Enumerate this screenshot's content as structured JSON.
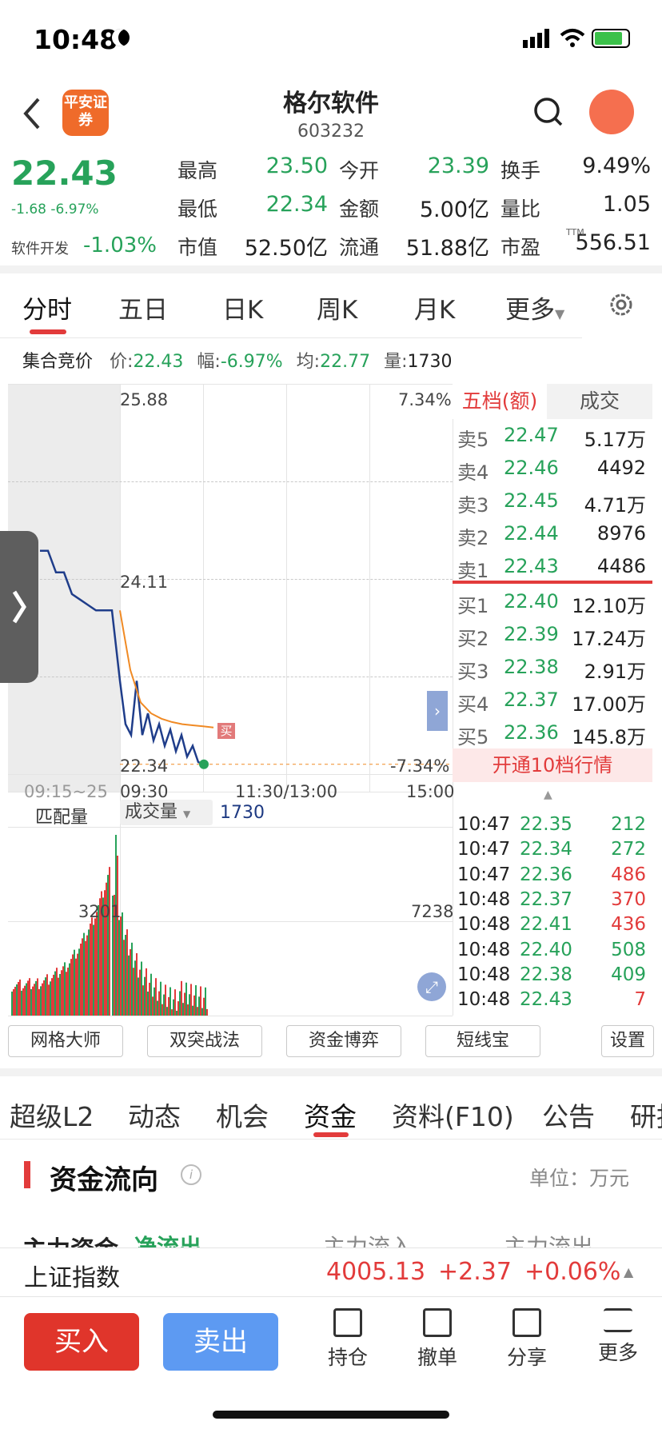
{
  "status_bar": {
    "time": "10:48"
  },
  "header": {
    "title": "格尔软件",
    "code": "603232",
    "broker_logo": "平安证券"
  },
  "quote": {
    "price": "22.43",
    "change": "-1.68",
    "change_pct": "-6.97%",
    "industry": "软件开发",
    "industry_pct": "-1.03%",
    "cells": [
      {
        "label": "最高",
        "value": "23.50",
        "color": "#27a25a"
      },
      {
        "label": "今开",
        "value": "23.39",
        "color": "#27a25a"
      },
      {
        "label": "换手",
        "value": "9.49%",
        "color": "#222"
      },
      {
        "label": "最低",
        "value": "22.34",
        "color": "#27a25a"
      },
      {
        "label": "金额",
        "value": "5.00亿",
        "color": "#222"
      },
      {
        "label": "量比",
        "value": "1.05",
        "color": "#222"
      },
      {
        "label": "市值",
        "value": "52.50亿",
        "color": "#222"
      },
      {
        "label": "流通",
        "value": "51.88亿",
        "color": "#222"
      },
      {
        "label": "市盈",
        "value": "556.51",
        "color": "#222"
      }
    ],
    "ttm_label": "TTM"
  },
  "chart_tabs": [
    "分时",
    "五日",
    "日K",
    "周K",
    "月K",
    "更多"
  ],
  "auction": {
    "label": "集合竞价",
    "price_label": "价:",
    "price": "22.43",
    "amp_label": "幅:",
    "amp": "-6.97%",
    "avg_label": "均:",
    "avg": "22.77",
    "vol_label": "量:",
    "vol": "1730"
  },
  "chart_data": {
    "type": "line",
    "y_top": "25.88",
    "y_mid": "24.11",
    "y_bot": "22.34",
    "pct_top": "7.34%",
    "pct_bot": "-7.34%",
    "x_labels": [
      "09:15~25",
      "09:30",
      "11:30/13:00",
      "15:00"
    ],
    "buy_marker": "买",
    "volume_label": "匹配量",
    "volume_select": "成交量",
    "volume_value": "1730",
    "volume_left_tick": "3201",
    "volume_right_tick": "7238",
    "series": [
      {
        "name": "price",
        "values": [
          24.4,
          24.4,
          24.2,
          24.2,
          24.0,
          23.95,
          23.9,
          23.85,
          23.85,
          23.85,
          23.2,
          22.8,
          22.7,
          23.2,
          22.7,
          22.9,
          22.65,
          22.8,
          22.6,
          22.75,
          22.55,
          22.7,
          22.5,
          22.6,
          22.45,
          22.43
        ]
      },
      {
        "name": "avg",
        "values": [
          23.85,
          23.3,
          23.0,
          22.9,
          22.85,
          22.82,
          22.8,
          22.79,
          22.78,
          22.77
        ]
      }
    ]
  },
  "orderbook": {
    "tab_active": "五档(额)",
    "tab_other": "成交",
    "asks": [
      {
        "label": "卖5",
        "price": "22.47",
        "vol": "5.17万"
      },
      {
        "label": "卖4",
        "price": "22.46",
        "vol": "4492"
      },
      {
        "label": "卖3",
        "price": "22.45",
        "vol": "4.71万"
      },
      {
        "label": "卖2",
        "price": "22.44",
        "vol": "8976"
      },
      {
        "label": "卖1",
        "price": "22.43",
        "vol": "4486"
      }
    ],
    "bids": [
      {
        "label": "买1",
        "price": "22.40",
        "vol": "12.10万"
      },
      {
        "label": "买2",
        "price": "22.39",
        "vol": "17.24万"
      },
      {
        "label": "买3",
        "price": "22.38",
        "vol": "2.91万"
      },
      {
        "label": "买4",
        "price": "22.37",
        "vol": "17.00万"
      },
      {
        "label": "买5",
        "price": "22.36",
        "vol": "145.8万"
      }
    ],
    "open10": "开通10档行情"
  },
  "trades": [
    {
      "time": "10:47",
      "price": "22.35",
      "vol": "212",
      "color": "#27a25a"
    },
    {
      "time": "10:47",
      "price": "22.34",
      "vol": "272",
      "color": "#27a25a"
    },
    {
      "time": "10:47",
      "price": "22.36",
      "vol": "486",
      "color": "#e23b3b"
    },
    {
      "time": "10:48",
      "price": "22.37",
      "vol": "370",
      "color": "#e23b3b"
    },
    {
      "time": "10:48",
      "price": "22.41",
      "vol": "436",
      "color": "#e23b3b"
    },
    {
      "time": "10:48",
      "price": "22.40",
      "vol": "508",
      "color": "#27a25a"
    },
    {
      "time": "10:48",
      "price": "22.38",
      "vol": "409",
      "color": "#27a25a"
    },
    {
      "time": "10:48",
      "price": "22.43",
      "vol": "7",
      "color": "#e23b3b"
    }
  ],
  "tools": [
    "网格大师",
    "双突战法",
    "资金博弈",
    "短线宝",
    "设置"
  ],
  "section_tabs": [
    "超级L2",
    "动态",
    "机会",
    "资金",
    "资料(F10)",
    "公告",
    "研报"
  ],
  "fund_flow": {
    "title": "资金流向",
    "unit": "单位：万元",
    "row_label": "主力资金",
    "net": "净流出",
    "inflow": "主力流入",
    "outflow": "主力流出"
  },
  "index_bar": {
    "name": "上证指数",
    "value": "4005.13",
    "change": "+2.37",
    "pct": "+0.06%"
  },
  "bottom": {
    "buy": "买入",
    "sell": "卖出",
    "tools": [
      "持仓",
      "撤单",
      "分享",
      "更多"
    ]
  }
}
